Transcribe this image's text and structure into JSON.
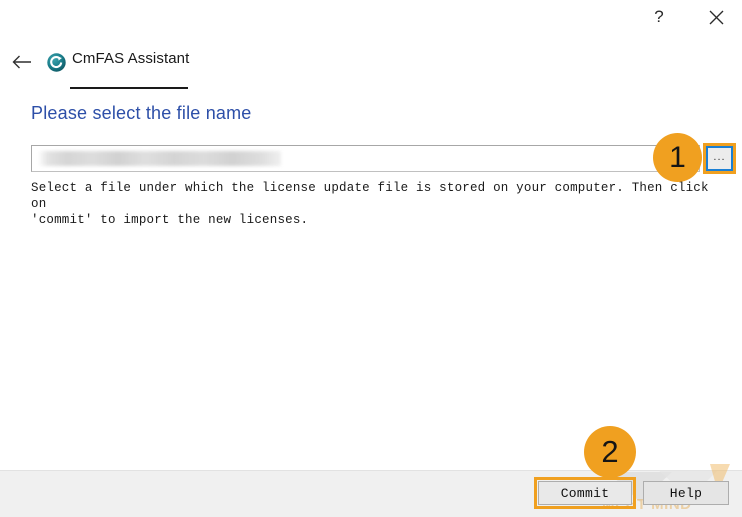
{
  "window": {
    "help_button": "?",
    "close_button": "✕"
  },
  "header": {
    "back_label": "←",
    "logo_name": "codemeter-logo-icon",
    "title": "CmFAS Assistant"
  },
  "content": {
    "heading": "Please select the file name",
    "file_path_value": "",
    "file_path_placeholder": "",
    "browse_label": "...",
    "description": "Select a file under which the license update file is stored on your computer. Then click on\n'commit' to import the new licenses."
  },
  "footer": {
    "commit_label": "Commit",
    "help_label": "Help",
    "watermark_text": "MEHT MIND"
  },
  "annotations": {
    "step_one": "1",
    "step_two": "2"
  },
  "colors": {
    "accent_orange": "#f0a020",
    "heading_blue": "#2d4fa8",
    "logo_teal": "#1b7f8c",
    "browse_border_blue": "#1a7fd4",
    "footer_bg": "#f0f0f0"
  }
}
